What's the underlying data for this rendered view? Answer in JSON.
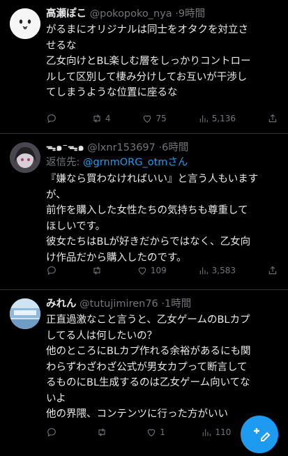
{
  "tweets": [
    {
      "name": "高瀬ぽこ",
      "handle": "@pokopoko_nya",
      "time": "9時間",
      "lines": [
        "がるまにオリジナルは同士をオタクを対立さ",
        "せるな",
        "乙女向けとBL楽しむ層をしっかりコントロー",
        "ルして区別して棲み分けしてお互いが干渉し",
        "てしまうような位置に座るな"
      ],
      "reply_count": "",
      "retweet_count": "4",
      "like_count": "75",
      "view_count": "5,136"
    },
    {
      "name": "ᯓ๑⁻ᯓ๑",
      "handle": "@lxnr153697",
      "time": "6時間",
      "reply_prefix": "返信先:",
      "reply_to": "@grnmORG_otmさん",
      "lines": [
        "『嫌なら買わなければいい』と言う人もいます",
        "が、",
        "前作を購入した女性たちの気持ちも尊重して",
        "ほしいです。",
        "彼女たちはBLが好きだからではなく、乙女向",
        "け作品だから購入したのです。"
      ],
      "reply_count": "",
      "retweet_count": "",
      "like_count": "109",
      "view_count": "3,583"
    },
    {
      "name": "みれん",
      "handle": "@tutujimiren76",
      "time": "1時間",
      "lines": [
        "正直過激なこと言うと、乙女ゲームのBLカプ",
        "してる人は何したいの？",
        "他のところにBLカプ作れる余裕があるにも関",
        "わらずわざわざ公式が男女カプって断言して",
        "るものにBL生成するのは乙女ゲーム向いてな",
        "いよ",
        "他の界隈、コンテンツに行った方がいい"
      ],
      "reply_count": "",
      "retweet_count": "",
      "like_count": "1",
      "view_count": "110"
    }
  ],
  "separator": "·",
  "icons": {
    "reply": "reply-icon",
    "retweet": "retweet-icon",
    "like": "heart-icon",
    "views": "views-icon",
    "share": "share-icon",
    "compose": "compose-icon"
  },
  "colors": {
    "background": "#000000",
    "text": "#e7e9ea",
    "muted": "#71767b",
    "link": "#1d9bf0"
  }
}
